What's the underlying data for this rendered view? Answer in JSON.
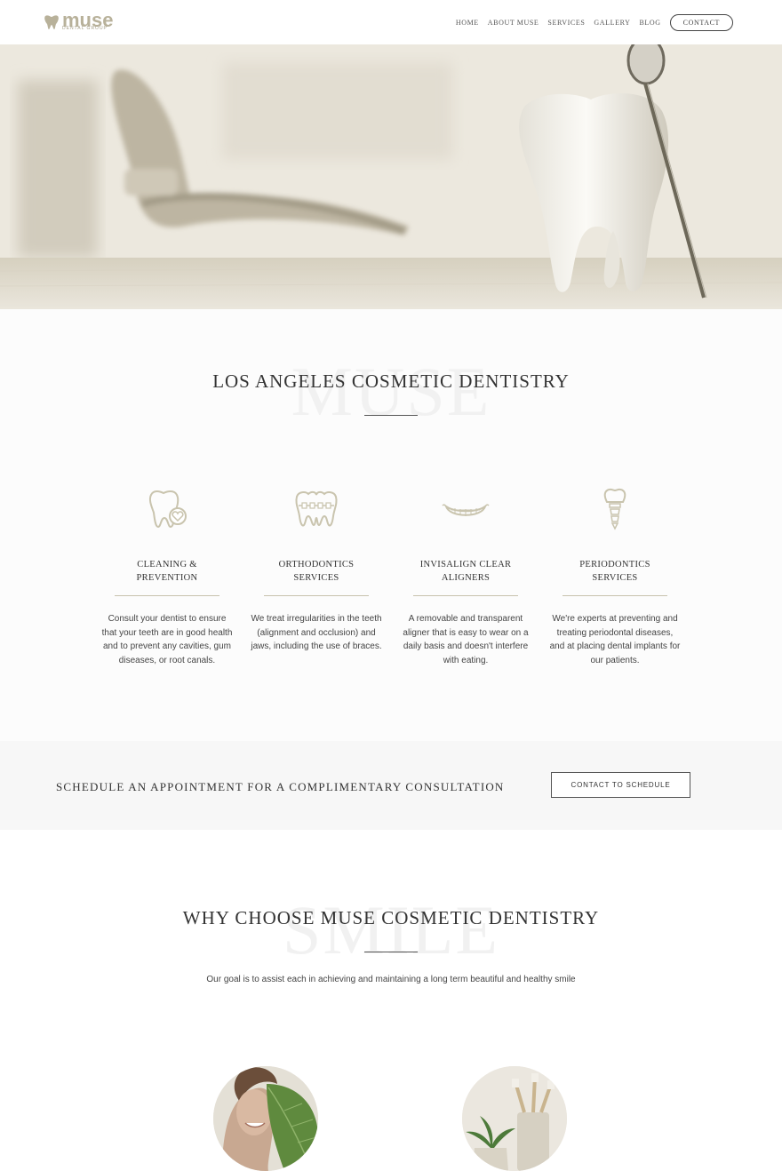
{
  "header": {
    "logo_text": "muse",
    "logo_subtext": "DENTAL GROUP",
    "nav": [
      "HOME",
      "ABOUT MUSE",
      "SERVICES",
      "GALLERY",
      "BLOG"
    ],
    "contact_label": "CONTACT"
  },
  "intro": {
    "watermark": "MUSE",
    "title": "LOS ANGELES COSMETIC DENTISTRY"
  },
  "services": [
    {
      "icon": "tooth-heart-icon",
      "title_line1": "CLEANING &",
      "title_line2": "PREVENTION",
      "description": "Consult your dentist to ensure that your teeth are in good health and to prevent any cavities, gum diseases, or root canals."
    },
    {
      "icon": "braces-icon",
      "title_line1": "ORTHODONTICS",
      "title_line2": "SERVICES",
      "description": "We treat irregularities in the teeth (alignment and occlusion) and jaws, including the use of braces."
    },
    {
      "icon": "smile-icon",
      "title_line1": "INVISALIGN CLEAR",
      "title_line2": "ALIGNERS",
      "description": "A removable and transparent aligner that is easy to wear on a daily basis and doesn't interfere with eating."
    },
    {
      "icon": "dental-implant-icon",
      "title_line1": "PERIODONTICS",
      "title_line2": "SERVICES",
      "description": "We're experts at preventing and treating periodontal diseases, and at placing dental implants for our patients."
    }
  ],
  "appointment": {
    "text": "SCHEDULE AN APPOINTMENT FOR A COMPLIMENTARY CONSULTATION",
    "button": "CONTACT TO SCHEDULE"
  },
  "why": {
    "watermark": "SMILE",
    "title": "WHY CHOOSE MUSE COSMETIC DENTISTRY",
    "description": "Our goal is to assist each in achieving and maintaining a long term beautiful and healthy smile"
  }
}
